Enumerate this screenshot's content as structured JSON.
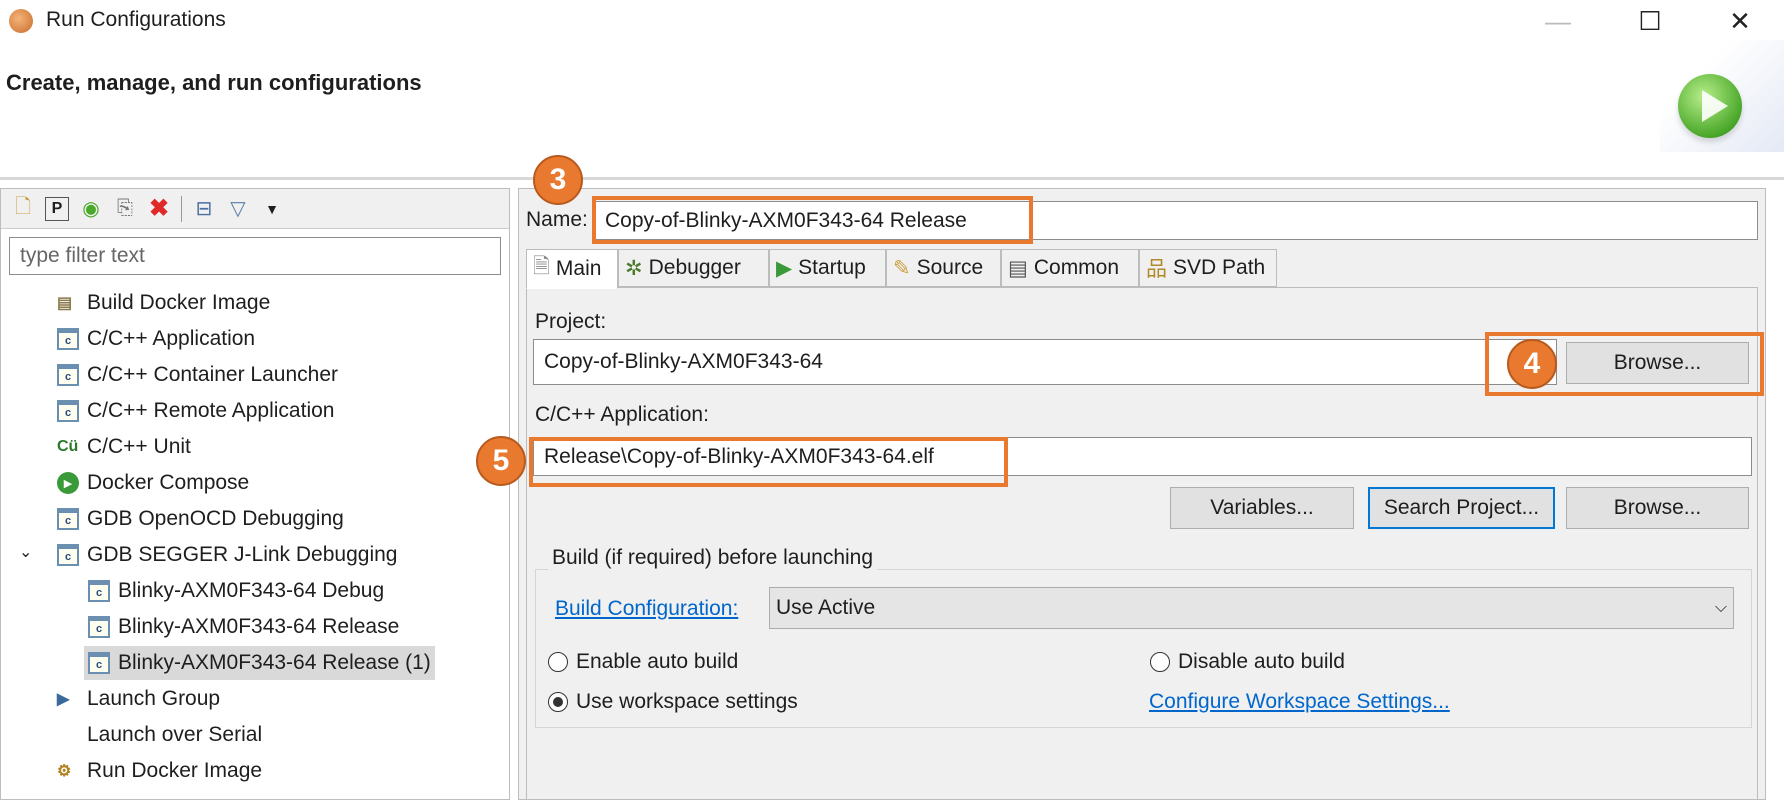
{
  "window": {
    "title": "Run Configurations",
    "minimize": "—",
    "maximize": "☐",
    "close": "✕"
  },
  "header": {
    "title": "Create, manage, and run configurations"
  },
  "toolbar": {
    "icons": [
      "new-config-icon",
      "new-prototype-icon",
      "export-icon",
      "duplicate-icon",
      "delete-icon",
      "collapse-all-icon",
      "filter-icon",
      "view-menu-icon"
    ]
  },
  "filter": {
    "placeholder": "type filter text"
  },
  "tree": {
    "items": [
      {
        "label": "Build Docker Image",
        "icon": "docker-build-icon"
      },
      {
        "label": "C/C++ Application",
        "icon": "c-launch-icon"
      },
      {
        "label": "C/C++ Container Launcher",
        "icon": "c-launch-icon"
      },
      {
        "label": "C/C++ Remote Application",
        "icon": "c-launch-icon"
      },
      {
        "label": "C/C++ Unit",
        "icon": "c-unit-icon"
      },
      {
        "label": "Docker Compose",
        "icon": "docker-compose-icon"
      },
      {
        "label": "GDB OpenOCD Debugging",
        "icon": "c-launch-icon"
      },
      {
        "label": "GDB SEGGER J-Link Debugging",
        "icon": "c-launch-icon",
        "expanded": true
      },
      {
        "label": "Blinky-AXM0F343-64 Debug",
        "icon": "c-launch-icon",
        "child": true
      },
      {
        "label": "Blinky-AXM0F343-64 Release",
        "icon": "c-launch-icon",
        "child": true
      },
      {
        "label": "Blinky-AXM0F343-64 Release (1)",
        "icon": "c-launch-icon",
        "child": true,
        "selected": true
      },
      {
        "label": "Launch Group",
        "icon": "launch-group-icon"
      },
      {
        "label": "Launch over Serial",
        "icon": ""
      },
      {
        "label": "Run Docker Image",
        "icon": "docker-run-icon"
      }
    ]
  },
  "config": {
    "name_label": "Name:",
    "name_value": "Copy-of-Blinky-AXM0F343-64 Release",
    "tabs": [
      {
        "label": "Main",
        "active": true
      },
      {
        "label": "Debugger"
      },
      {
        "label": "Startup"
      },
      {
        "label": "Source"
      },
      {
        "label": "Common"
      },
      {
        "label": "SVD Path"
      }
    ],
    "project_label": "Project:",
    "project_value": "Copy-of-Blinky-AXM0F343-64",
    "browse": "Browse...",
    "app_label": "C/C++ Application:",
    "app_value": "Release\\Copy-of-Blinky-AXM0F343-64.elf",
    "variables": "Variables...",
    "search_project": "Search Project...",
    "browse2": "Browse...",
    "build_group": "Build (if required) before launching",
    "build_config_link": "Build Configuration:",
    "build_config_value": "Use Active",
    "enable_auto": "Enable auto build",
    "disable_auto": "Disable auto build",
    "use_workspace": "Use workspace settings",
    "configure_link": "Configure Workspace Settings...",
    "selected_radio": "Use workspace settings"
  },
  "annotations": {
    "a3": "3",
    "a4": "4",
    "a5": "5",
    "color": "#e8792f"
  }
}
